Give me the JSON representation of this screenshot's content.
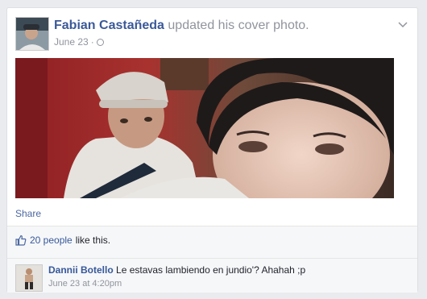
{
  "post": {
    "author_name": "Fabian Castañeda",
    "action_text": "updated his cover photo.",
    "timestamp": "June 23",
    "separator": "·",
    "share_label": "Share"
  },
  "likes": {
    "count_text": "20 people",
    "suffix": "like this."
  },
  "comment": {
    "author_name": "Dannii Botello",
    "text": "Le estavas lambiendo en jundio'? Ahahah ;p",
    "timestamp": "June 23 at 4:20pm"
  },
  "colors": {
    "link_blue": "#3b5998",
    "meta_gray": "#90949c"
  },
  "icons": {
    "privacy": "globe-icon",
    "menu": "chevron-down-icon",
    "like": "thumbs-up-icon"
  }
}
